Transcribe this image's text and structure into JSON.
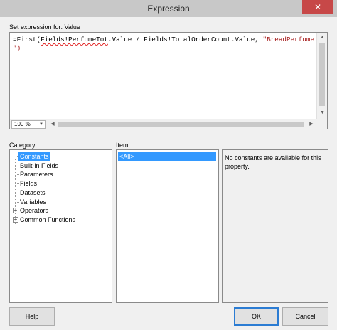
{
  "window": {
    "title": "Expression",
    "close_glyph": "✕"
  },
  "expression": {
    "label": "Set expression for: Value",
    "line1_prefix": "=First(",
    "line1_err": "Fields!PerfumeTot",
    "line1_mid": ".Value / Fields!TotalOrderCount.Value, ",
    "line1_str": "\"BreadPerfumeJaguar",
    "line2_str": "\")",
    "zoom": "100 %"
  },
  "category": {
    "label": "Category:",
    "items": [
      {
        "label": "Constants",
        "selected": true,
        "expandable": false
      },
      {
        "label": "Built-in Fields",
        "expandable": false
      },
      {
        "label": "Parameters",
        "expandable": false
      },
      {
        "label": "Fields",
        "expandable": false
      },
      {
        "label": "Datasets",
        "expandable": false
      },
      {
        "label": "Variables",
        "expandable": false
      },
      {
        "label": "Operators",
        "expandable": true
      },
      {
        "label": "Common Functions",
        "expandable": true
      }
    ]
  },
  "item": {
    "label": "Item:",
    "rows": [
      "<All>"
    ]
  },
  "description": {
    "text": "No constants are available for this property."
  },
  "buttons": {
    "help": "Help",
    "ok": "OK",
    "cancel": "Cancel"
  },
  "colors": {
    "selection": "#3399ff",
    "close": "#c74848",
    "string": "#a31515"
  }
}
